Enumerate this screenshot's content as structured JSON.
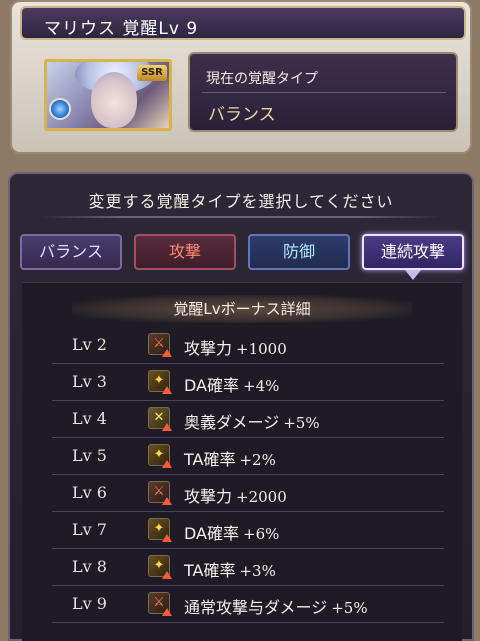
{
  "header": {
    "title": "マリウス 覚醒Lv 9"
  },
  "character": {
    "rarity_badge": "SSR",
    "portrait_icon": "character-portrait",
    "element_icon": "water-element-icon"
  },
  "awakening": {
    "label": "現在の覚醒タイプ",
    "value": "バランス"
  },
  "selection": {
    "instruction": "変更する覚醒タイプを選択してください",
    "tabs": [
      {
        "label": "バランス",
        "selected": false
      },
      {
        "label": "攻撃",
        "selected": false
      },
      {
        "label": "防御",
        "selected": false
      },
      {
        "label": "連続攻撃",
        "selected": true
      }
    ]
  },
  "bonus": {
    "header": "覚醒Lvボーナス詳細",
    "rows": [
      {
        "lv": "Lv 2",
        "icon": "attack-up-icon",
        "text": "攻撃力",
        "value": "+1000"
      },
      {
        "lv": "Lv 3",
        "icon": "multiattack-up-icon",
        "text": "DA確率",
        "value": "+4%"
      },
      {
        "lv": "Lv 4",
        "icon": "special-attack-up-icon",
        "text": "奥義ダメージ",
        "value": "+5%"
      },
      {
        "lv": "Lv 5",
        "icon": "multiattack-up-icon",
        "text": "TA確率",
        "value": "+2%"
      },
      {
        "lv": "Lv 6",
        "icon": "attack-up-icon",
        "text": "攻撃力",
        "value": "+2000"
      },
      {
        "lv": "Lv 7",
        "icon": "multiattack-up-icon",
        "text": "DA確率",
        "value": "+6%"
      },
      {
        "lv": "Lv 8",
        "icon": "multiattack-up-icon",
        "text": "TA確率",
        "value": "+3%"
      },
      {
        "lv": "Lv 9",
        "icon": "attack-up-icon",
        "text": "通常攻撃与ダメージ",
        "value": "+5%"
      }
    ]
  },
  "colors": {
    "panel_bg": "#241f2c",
    "attack_tab_text": "#ff8a72",
    "defense_tab_text": "#aee8ff",
    "balance_value": "#f1d6a4"
  }
}
